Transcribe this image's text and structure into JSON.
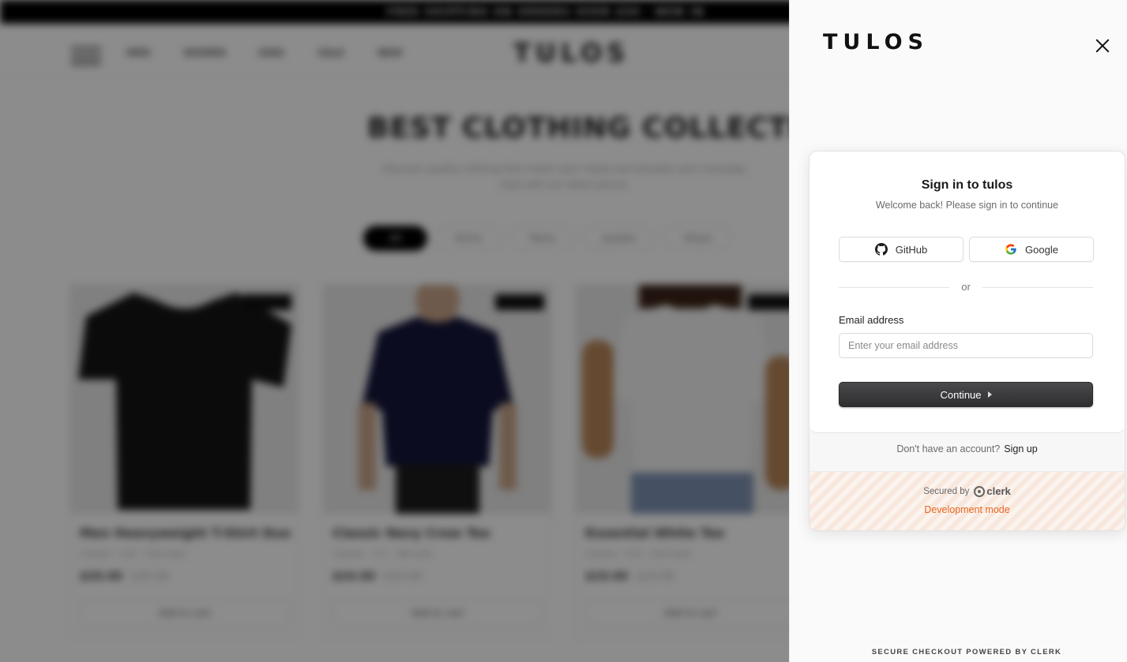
{
  "background": {
    "announcement": "FREE SHIPPING ON ORDERS OVER $50  ·  NEW IN",
    "nav_links": [
      "MEN",
      "WOMEN",
      "KIDS",
      "SALE",
      "NEW"
    ],
    "logo": "TULOS",
    "hero_title": "BEST CLOTHING COLLECTION",
    "hero_subtitle": "Discover quality clothing that meets your needs and elevates your everyday style with our latest pieces.",
    "filters": [
      "All",
      "Shirts",
      "Pants",
      "Jackets",
      "Shoes"
    ],
    "products": [
      {
        "name": "Men Heavyweight T-Shirt Duo",
        "meta": "Cotton · 4.8 · 120 sold",
        "price": "$29.99",
        "old_price": "$39.99",
        "button": "Add to cart"
      },
      {
        "name": "Classic Navy Crew Tee",
        "meta": "Cotton · 4.7 · 98 sold",
        "price": "$24.99",
        "old_price": "$34.99",
        "button": "Add to cart"
      },
      {
        "name": "Essential White Tee",
        "meta": "Cotton · 4.9 · 210 sold",
        "price": "$19.99",
        "old_price": "$29.99",
        "button": "Add to cart"
      }
    ]
  },
  "drawer": {
    "logo": "TULOS",
    "footer": "SECURE CHECKOUT POWERED BY CLERK"
  },
  "auth": {
    "title": "Sign in to tulos",
    "subtitle": "Welcome back! Please sign in to continue",
    "github_label": "GitHub",
    "google_label": "Google",
    "divider": "or",
    "email_label": "Email address",
    "email_placeholder": "Enter your email address",
    "email_value": "",
    "continue_label": "Continue",
    "no_account_text": "Don't have an account?",
    "signup_label": "Sign up",
    "secured_by": "Secured by",
    "clerk_brand": "clerk",
    "dev_mode": "Development mode"
  },
  "colors": {
    "dev_mode": "#e8651f",
    "button_dark": "#2e2e31"
  }
}
